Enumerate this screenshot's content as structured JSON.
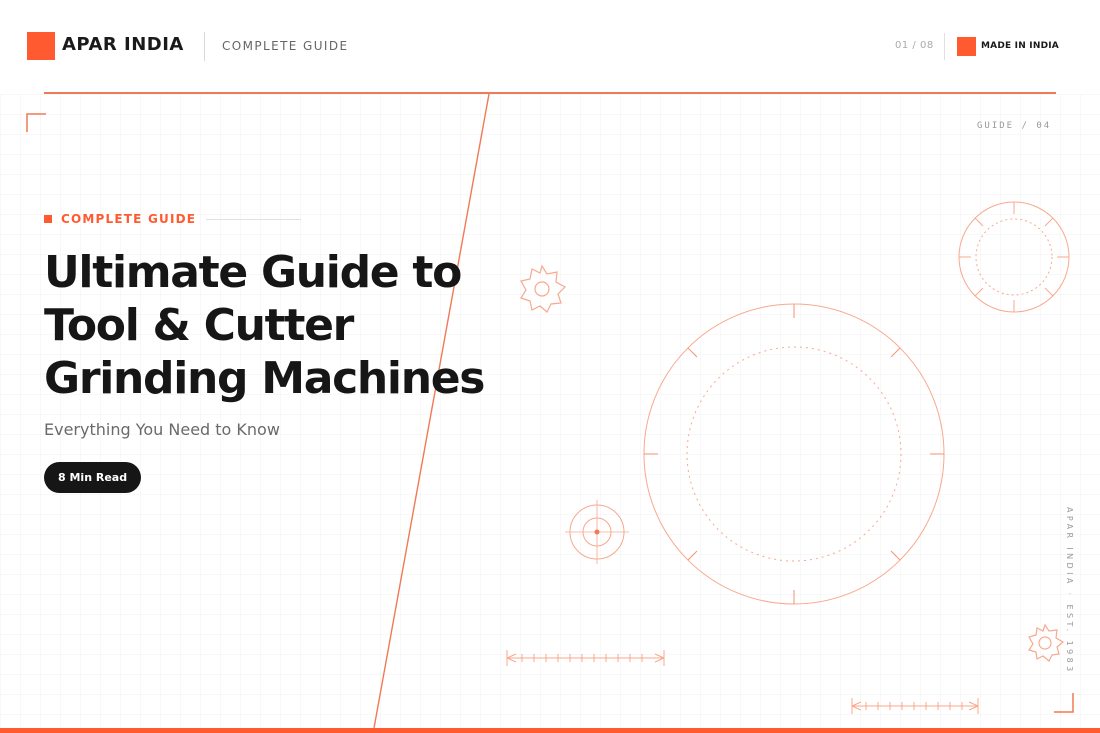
{
  "brand": {
    "name": "APAR INDIA",
    "accent_color": "#ff5a30"
  },
  "header": {
    "section_label": "COMPLETE GUIDE",
    "page_indicator": "01 / 08",
    "made_in_label": "MADE IN INDIA"
  },
  "hero": {
    "kicker": "COMPLETE GUIDE",
    "title_lines": [
      "Ultimate Guide to",
      "Tool & Cutter",
      "Grinding Machines"
    ],
    "subtitle": "Everything You Need to Know",
    "read_time": "8 Min Read"
  },
  "decor": {
    "guide_code": "GUIDE / 04",
    "vertical_text": "APAR INDIA · EST. 1983",
    "icons": [
      "gear-icon",
      "crosshair-icon",
      "dial-icon",
      "dimension-arrow-icon",
      "corner-bracket-icon"
    ]
  }
}
